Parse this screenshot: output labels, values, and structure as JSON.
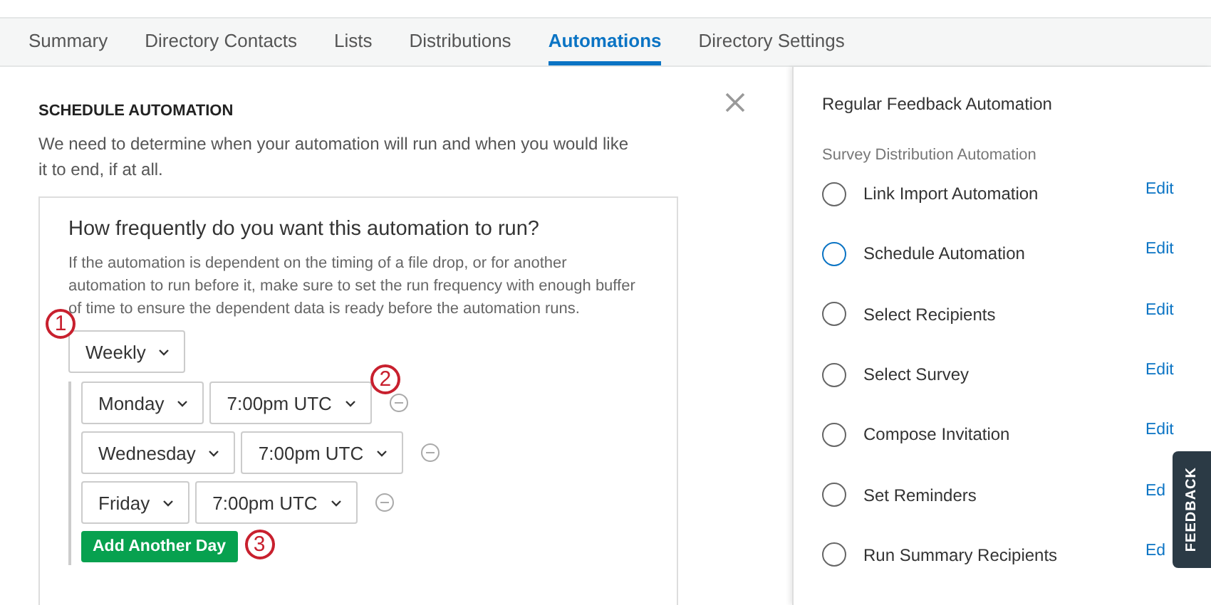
{
  "tabs": [
    {
      "label": "Summary",
      "selected": false
    },
    {
      "label": "Directory Contacts",
      "selected": false
    },
    {
      "label": "Lists",
      "selected": false
    },
    {
      "label": "Distributions",
      "selected": false
    },
    {
      "label": "Automations",
      "selected": true
    },
    {
      "label": "Directory Settings",
      "selected": false
    }
  ],
  "panel": {
    "title": "SCHEDULE AUTOMATION",
    "description": "We need to determine when your automation will run and when you would like it to end, if at all.",
    "card": {
      "question": "How frequently do you want this automation to run?",
      "help": "If the automation is dependent on the timing of a file drop, or for another automation to run before it, make sure to set the run frequency with enough buffer of time to ensure the dependent data is ready before the automation runs.",
      "frequency": {
        "value": "Weekly",
        "callout": "1"
      },
      "days": [
        {
          "day": "Monday",
          "time": "7:00pm UTC",
          "callout": "2"
        },
        {
          "day": "Wednesday",
          "time": "7:00pm UTC"
        },
        {
          "day": "Friday",
          "time": "7:00pm UTC"
        }
      ],
      "add_button": {
        "label": "Add Another Day",
        "callout": "3"
      }
    }
  },
  "sidebar": {
    "title": "Regular Feedback Automation",
    "subtitle": "Survey Distribution Automation",
    "steps": [
      {
        "label": "Link Import Automation",
        "edit": "Edit",
        "selected": false
      },
      {
        "label": "Schedule Automation",
        "edit": "Edit",
        "selected": true
      },
      {
        "label": "Select Recipients",
        "edit": "Edit",
        "selected": false
      },
      {
        "label": "Select Survey",
        "edit": "Edit",
        "selected": false
      },
      {
        "label": "Compose Invitation",
        "edit": "Edit",
        "selected": false
      },
      {
        "label": "Set Reminders",
        "edit": "Ed",
        "selected": false
      },
      {
        "label": "Run Summary Recipients",
        "edit": "Ed",
        "selected": false
      }
    ]
  },
  "feedback_tab": "FEEDBACK"
}
